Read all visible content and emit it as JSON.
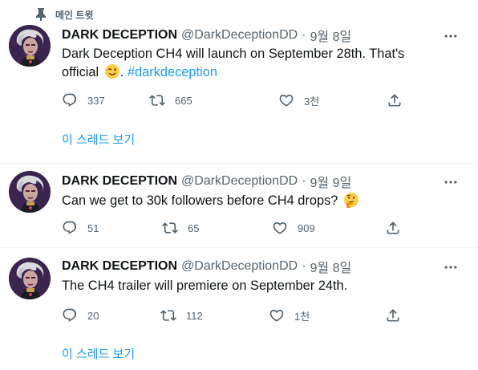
{
  "pinned": {
    "label": "메인 트윗"
  },
  "tweets": [
    {
      "name": "DARK DECEPTION",
      "handle": "@DarkDeceptionDD",
      "separator": "·",
      "date": "9월 8일",
      "text_part1": "Dark Deception CH4 will launch on September 28th. That's",
      "text_part2": "official",
      "text_part2_suffix": ". ",
      "hashtag": "#darkdeception",
      "emoji": "wink-face-emoji",
      "replies": "337",
      "retweets": "665",
      "likes": "3천",
      "show_thread": "이 스레드 보기"
    },
    {
      "name": "DARK DECEPTION",
      "handle": "@DarkDeceptionDD",
      "separator": "·",
      "date": "9월 9일",
      "text": "Can we get to 30k followers before CH4 drops?",
      "emoji": "thinking-face-emoji",
      "replies": "51",
      "retweets": "65",
      "likes": "909"
    },
    {
      "name": "DARK DECEPTION",
      "handle": "@DarkDeceptionDD",
      "separator": "·",
      "date": "9월 8일",
      "text": "The CH4 trailer will premiere on September 24th.",
      "replies": "20",
      "retweets": "112",
      "likes": "1천",
      "show_thread": "이 스레드 보기"
    }
  ],
  "colors": {
    "accent": "#1d9bf0",
    "secondary_text": "#536471",
    "primary_text": "#0f1419",
    "divider": "#eff3f4"
  }
}
